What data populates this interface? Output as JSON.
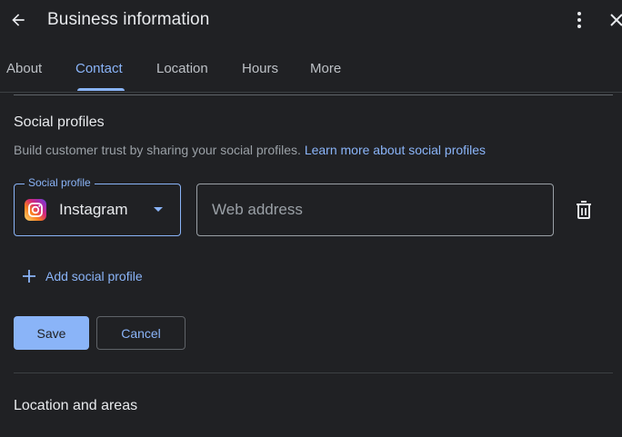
{
  "header": {
    "title": "Business information",
    "back_icon": "arrow-back-icon",
    "more_icon": "more-vert-icon",
    "close_icon": "close-icon"
  },
  "tabs": [
    {
      "label": "About",
      "active": false
    },
    {
      "label": "Contact",
      "active": true
    },
    {
      "label": "Location",
      "active": false
    },
    {
      "label": "Hours",
      "active": false
    },
    {
      "label": "More",
      "active": false
    }
  ],
  "social": {
    "title": "Social profiles",
    "description": "Build customer trust by sharing your social profiles.",
    "learn_more": "Learn more about social profiles",
    "select_label": "Social profile",
    "select_value": "Instagram",
    "select_icon": "instagram-icon",
    "web_placeholder": "Web address",
    "web_value": "",
    "delete_icon": "delete-icon",
    "add_label": "Add social profile"
  },
  "actions": {
    "save": "Save",
    "cancel": "Cancel"
  },
  "next_section": {
    "title": "Location and areas"
  },
  "colors": {
    "background": "#202124",
    "accent": "#8ab4f8",
    "text": "#e8eaed",
    "muted": "#9aa0a6"
  }
}
